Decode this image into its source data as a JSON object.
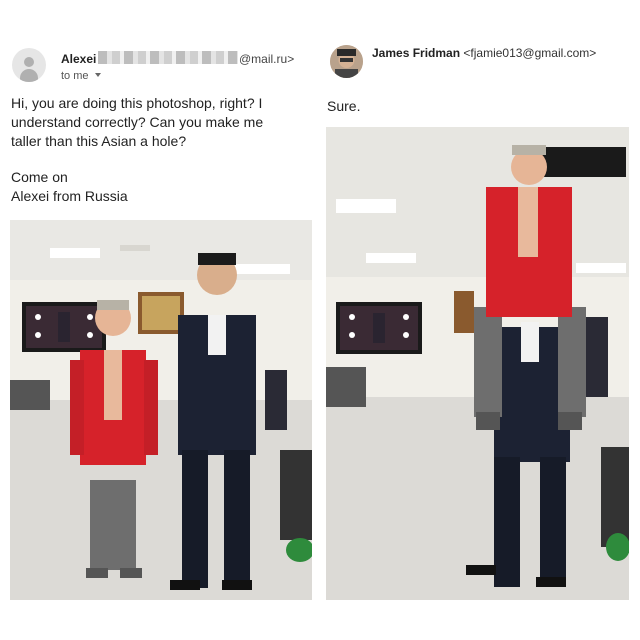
{
  "left_email": {
    "sender_name": "Alexei",
    "sender_domain": "@mail.ru>",
    "recipient_label": "to me",
    "message": "Hi, you are doing this photoshop, right? I\nunderstand correctly? Can you make me\ntaller than this Asian a hole?",
    "signature": "Come on\nAlexei from Russia",
    "photo": {
      "alt": "Original photo: man in red blazer standing next to taller man in dark suit"
    }
  },
  "right_email": {
    "sender_name": "James Fridman",
    "sender_email": "<fjamie013@gmail.com>",
    "reply": "Sure.",
    "photo": {
      "alt": "Edited photo: man in red blazer sitting on the shoulders of the man in dark suit"
    }
  },
  "icons": [
    "person-avatar-icon",
    "chevron-down-icon",
    "sender-photo-avatar"
  ],
  "colors": {
    "blazer_red": "#d6222a",
    "suit_navy": "#1c2233",
    "text": "#222222"
  }
}
